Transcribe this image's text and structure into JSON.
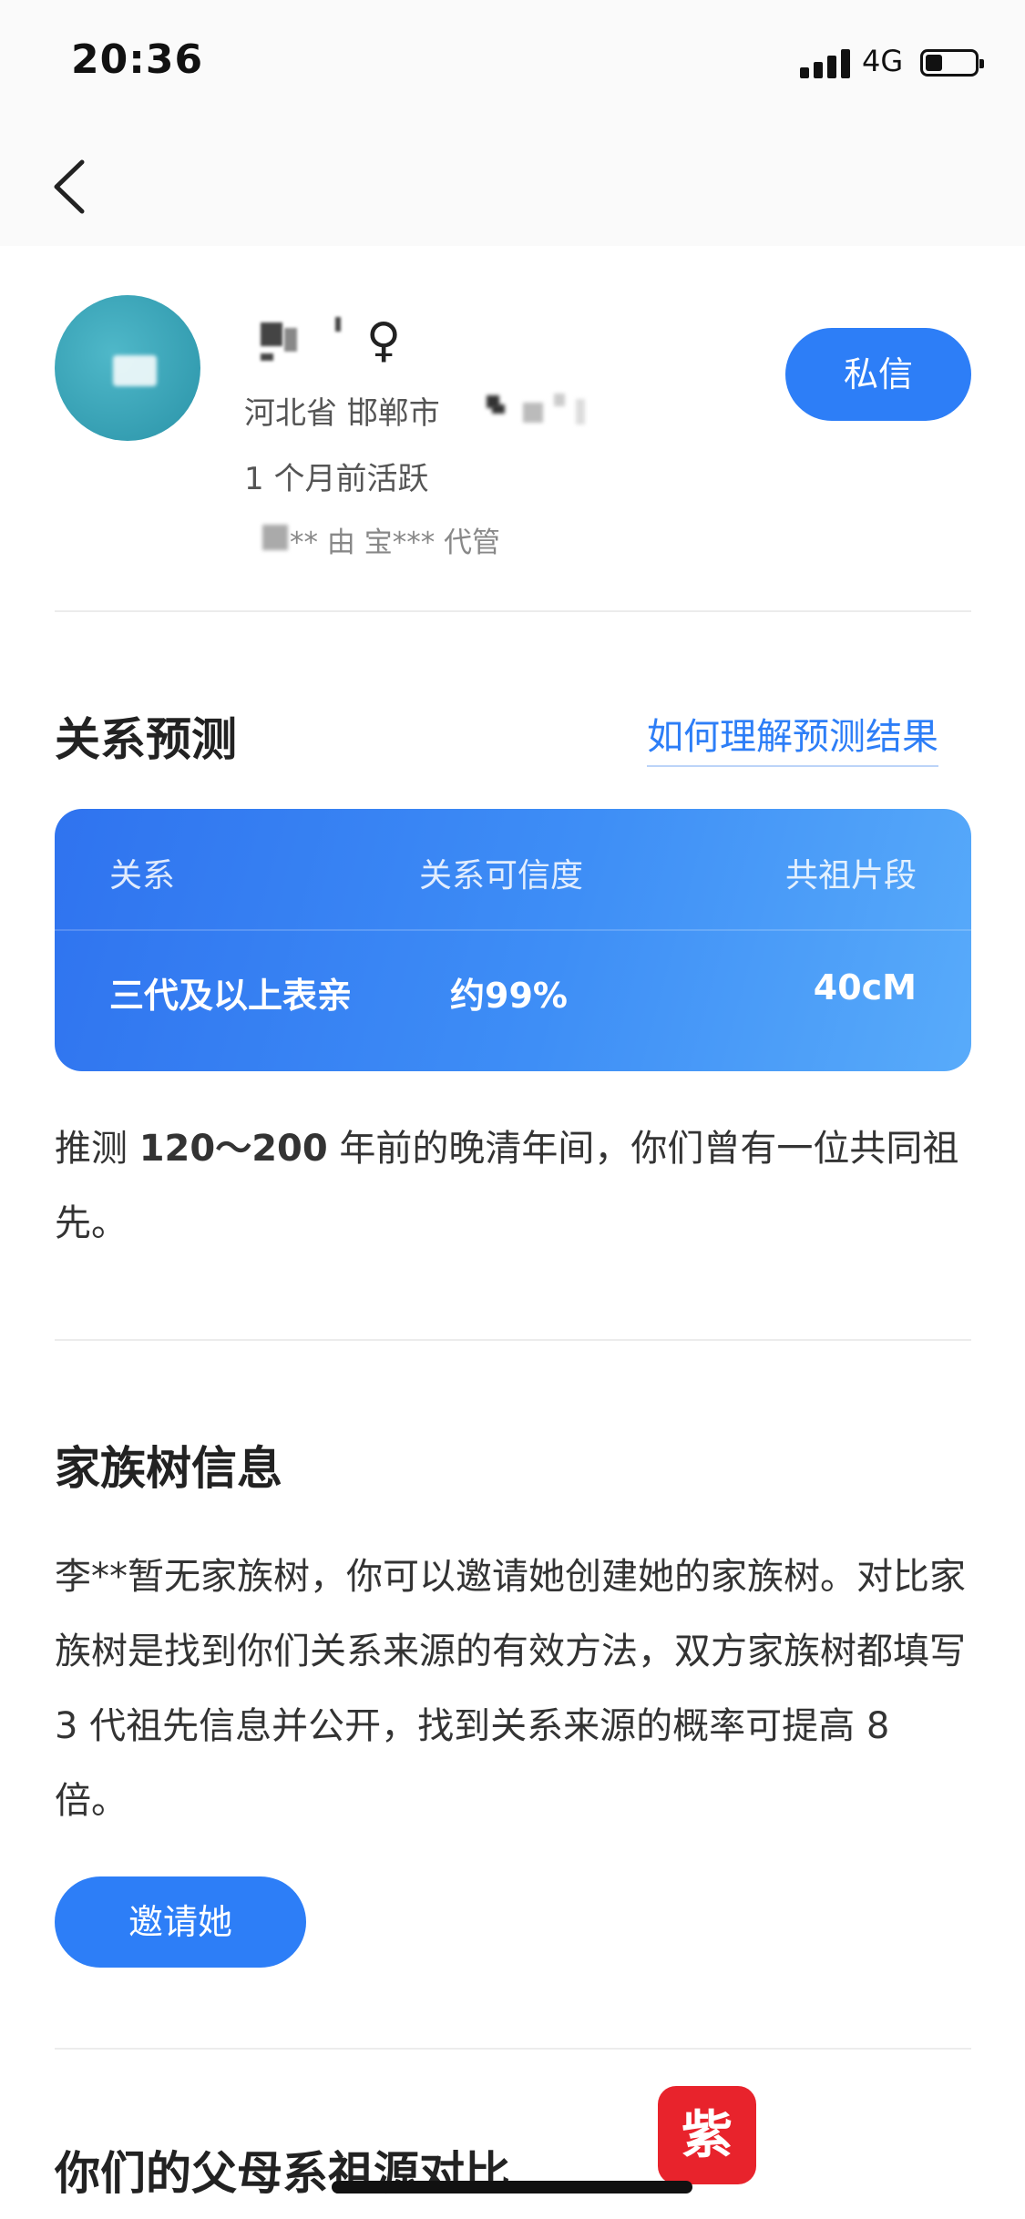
{
  "status_bar": {
    "time": "20:36",
    "network": "4G"
  },
  "profile": {
    "gender_symbol": "♀",
    "location": "河北省 邯郸市",
    "last_active": "1 个月前活跃",
    "managed_by": "** 由 宝*** 代管",
    "message_button": "私信"
  },
  "relationship": {
    "title": "关系预测",
    "help_link": "如何理解预测结果",
    "headers": {
      "relation": "关系",
      "confidence": "关系可信度",
      "segment": "共祖片段"
    },
    "values": {
      "relation": "三代及以上表亲",
      "confidence": "约99%",
      "segment": "40cM"
    },
    "estimate_prefix": "推测 ",
    "estimate_range": "120～200",
    "estimate_suffix": " 年前的晚清年间，你们曾有一位共同祖先。"
  },
  "family_tree": {
    "title": "家族树信息",
    "description": "李**暂无家族树，你可以邀请她创建她的家族树。对比家族树是找到你们关系来源的有效方法，双方家族树都填写 3 代祖先信息并公开，找到关系来源的概率可提高 8 倍。",
    "invite_button": "邀请她"
  },
  "parent_origin": {
    "title": "你们的父母系祖源对比"
  },
  "watermark": {
    "text": "紫牛"
  },
  "colors": {
    "accent": "#2d7ef7",
    "card_gradient_start": "#2f73ef",
    "card_gradient_end": "#58abfa",
    "badge": "#e8232c"
  },
  "icons": {
    "back": "chevron-left-icon",
    "signal": "signal-bars-icon",
    "battery": "battery-icon",
    "gender": "female-icon"
  }
}
